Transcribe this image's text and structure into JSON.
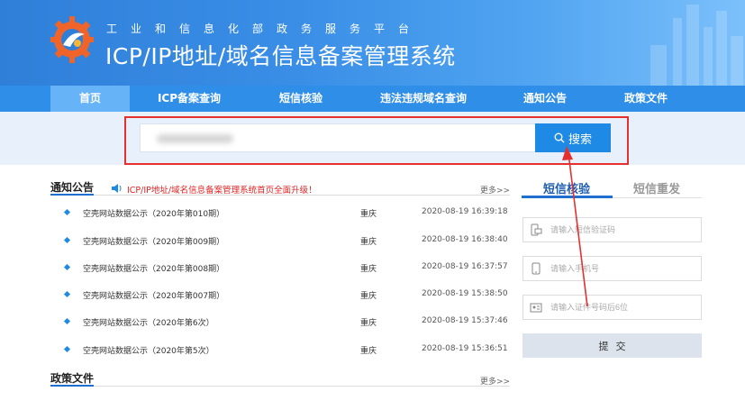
{
  "header": {
    "subtitle": "工业和信息化部政务服务平台",
    "title": "ICP/IP地址/域名信息备案管理系统"
  },
  "nav": {
    "items": [
      "首页",
      "ICP备案查询",
      "短信核验",
      "违法违规域名查询",
      "通知公告",
      "政策文件"
    ],
    "active": "首页"
  },
  "search": {
    "value": "",
    "button_label": "搜索",
    "icon": "search-icon"
  },
  "notices": {
    "title": "通知公告",
    "marquee": "ICP/IP地址/域名信息备案管理系统首页全面升级！",
    "more": "更多>>",
    "items": [
      {
        "title": "空壳网站数据公示（2020年第010期）",
        "location": "重庆",
        "time": "2020-08-19 16:39:18"
      },
      {
        "title": "空壳网站数据公示（2020年第009期）",
        "location": "重庆",
        "time": "2020-08-19 16:38:40"
      },
      {
        "title": "空壳网站数据公示（2020年第008期）",
        "location": "重庆",
        "time": "2020-08-19 16:37:57"
      },
      {
        "title": "空壳网站数据公示（2020年第007期）",
        "location": "重庆",
        "time": "2020-08-19 15:38:50"
      },
      {
        "title": "空壳网站数据公示（2020年第6次）",
        "location": "重庆",
        "time": "2020-08-19 15:37:46"
      },
      {
        "title": "空壳网站数据公示（2020年第5次）",
        "location": "重庆",
        "time": "2020-08-19 15:36:51"
      }
    ]
  },
  "policy": {
    "title": "政策文件",
    "more": "更多>>"
  },
  "sms": {
    "tab_active": "短信核验",
    "tab_inactive": "短信重发",
    "verify_placeholder": "请输入短信验证码",
    "phone_placeholder": "请输入手机号",
    "id_placeholder": "请输入证件号码后6位",
    "submit_label": "提交"
  },
  "colors": {
    "header_blue": "#2f7fd9",
    "nav_blue": "#2f8fe8",
    "accent": "#1f8ae6",
    "highlight_red": "#e4302f"
  }
}
